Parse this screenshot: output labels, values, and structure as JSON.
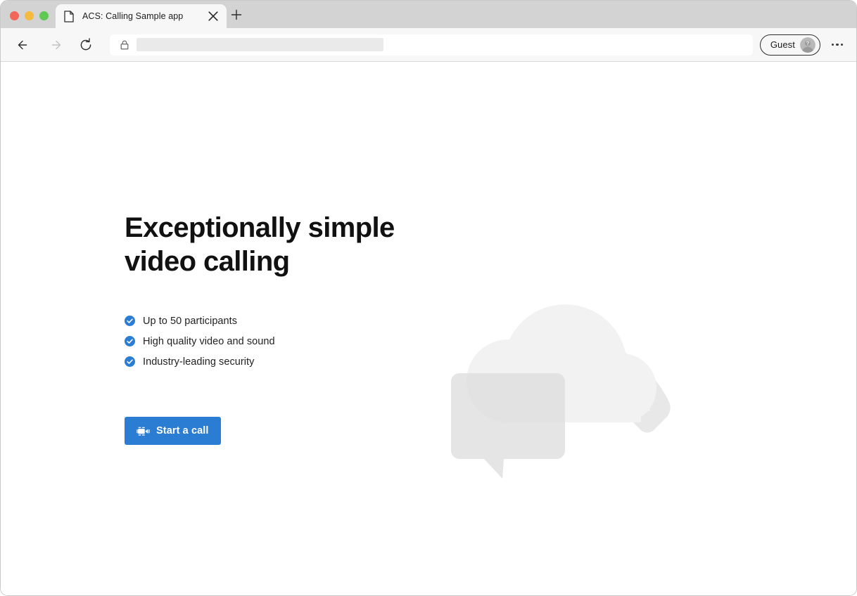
{
  "browser": {
    "window_controls": [
      {
        "name": "close",
        "color": "#f0675a"
      },
      {
        "name": "minimize",
        "color": "#f5bb3e"
      },
      {
        "name": "zoom",
        "color": "#5fc953"
      }
    ],
    "tabs": [
      {
        "title": "ACS: Calling Sample app",
        "favicon": "page-icon",
        "active": true
      }
    ],
    "new_tab_label": "+",
    "nav": {
      "back_label": "Back",
      "forward_label": "Forward",
      "forward_enabled": false,
      "reload_label": "Reload"
    },
    "omnibox": {
      "security_icon": "lock-icon",
      "value": "",
      "placeholder": "",
      "redacted": true
    },
    "profile": {
      "label": "Guest",
      "avatar_icon": "unknown-person-icon"
    },
    "more_menu_label": "..."
  },
  "page": {
    "title": "Exceptionally simple\nvideo calling",
    "features": [
      {
        "icon": "check-circle-icon",
        "text": "Up to 50 participants"
      },
      {
        "icon": "check-circle-icon",
        "text": "High quality video and sound"
      },
      {
        "icon": "check-circle-icon",
        "text": "Industry-leading security"
      }
    ],
    "cta": {
      "label": "Start a call",
      "icon": "video-camera-icon"
    },
    "illustration": {
      "name": "cloud-phone-chat-illustration",
      "shapes": [
        "cloud",
        "phone-handset",
        "chat-bubble"
      ]
    }
  },
  "colors": {
    "accent": "#2b7cd3",
    "check": "#2b7cd3",
    "heading": "#111111",
    "body_text": "#222222",
    "page_background": "#ffffff",
    "art_light": "#f2f2f2",
    "art_mid": "#e8e8e8",
    "tab_strip": "#d3d3d3",
    "toolbar": "#f7f7f7"
  }
}
